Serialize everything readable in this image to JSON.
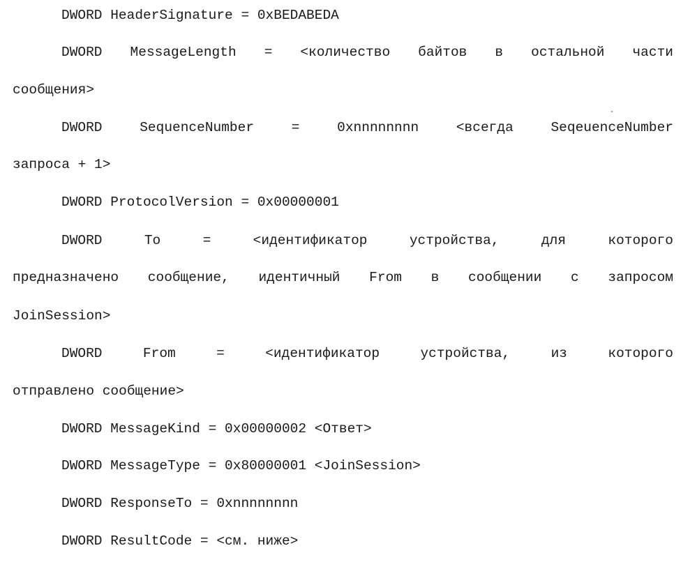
{
  "document": {
    "lines": [
      {
        "text": "DWORD HeaderSignature = 0xBEDABEDA",
        "indent": true,
        "justify": false
      },
      {
        "text": "DWORD MessageLength = <количество байтов в остальной части",
        "indent": true,
        "justify": true
      },
      {
        "text": "сообщения>",
        "indent": false,
        "justify": false
      },
      {
        "text": "DWORD SequenceNumber = 0xnnnnnnnn <всегда SeqeuenceNumber",
        "indent": true,
        "justify": true
      },
      {
        "text": "запроса + 1>",
        "indent": false,
        "justify": false
      },
      {
        "text": "DWORD ProtocolVersion = 0x00000001",
        "indent": true,
        "justify": false
      },
      {
        "text": "DWORD To = <идентификатор устройства, для которого",
        "indent": true,
        "justify": true
      },
      {
        "text": "предназначено сообщение, идентичный From в сообщении с запросом",
        "indent": false,
        "justify": true
      },
      {
        "text": "JoinSession>",
        "indent": false,
        "justify": false
      },
      {
        "text": "DWORD From = <идентификатор устройства, из которого",
        "indent": true,
        "justify": true
      },
      {
        "text": "отправлено сообщение>",
        "indent": false,
        "justify": false
      },
      {
        "text": "DWORD MessageKind = 0x00000002 <Ответ>",
        "indent": true,
        "justify": false
      },
      {
        "text": "DWORD MessageType = 0x80000001 <JoinSession>",
        "indent": true,
        "justify": false
      },
      {
        "text": "DWORD ResponseTo = 0xnnnnnnnn",
        "indent": true,
        "justify": false
      },
      {
        "text": "DWORD ResultCode = <см. ниже>",
        "indent": true,
        "justify": false
      }
    ]
  }
}
